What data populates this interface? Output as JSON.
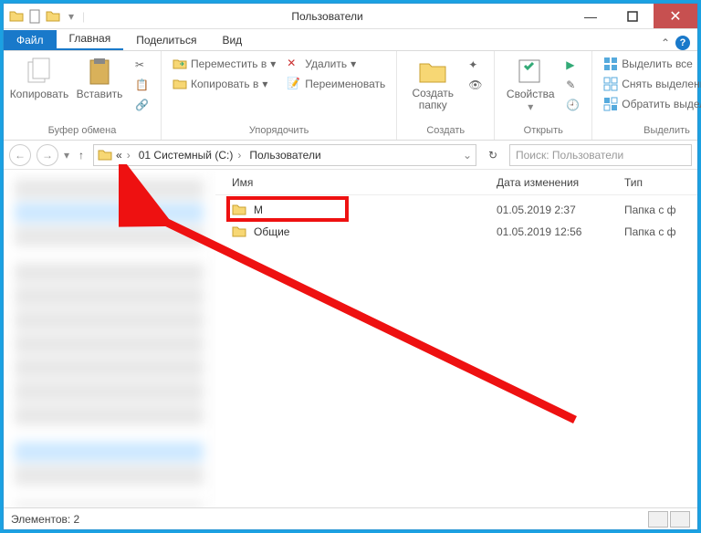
{
  "window": {
    "title": "Пользователи"
  },
  "tabs": {
    "file": "Файл",
    "home": "Главная",
    "share": "Поделиться",
    "view": "Вид"
  },
  "ribbon": {
    "clipboard": {
      "copy": "Копировать",
      "paste": "Вставить",
      "label": "Буфер обмена"
    },
    "organize": {
      "move": "Переместить в",
      "copyTo": "Копировать в",
      "delete": "Удалить",
      "rename": "Переименовать",
      "label": "Упорядочить"
    },
    "new": {
      "folder": "Создать папку",
      "label": "Создать"
    },
    "open": {
      "props": "Свойства",
      "label": "Открыть"
    },
    "select": {
      "all": "Выделить все",
      "none": "Снять выделение",
      "invert": "Обратить выделение",
      "label": "Выделить"
    }
  },
  "breadcrumbs": {
    "drive": "01 Системный (C:)",
    "folder": "Пользователи"
  },
  "search": {
    "placeholder": "Поиск: Пользователи"
  },
  "columns": {
    "name": "Имя",
    "date": "Дата изменения",
    "type": "Тип"
  },
  "items": [
    {
      "name": "M",
      "date": "01.05.2019 2:37",
      "type": "Папка с ф"
    },
    {
      "name": "Общие",
      "date": "01.05.2019 12:56",
      "type": "Папка с ф"
    }
  ],
  "status": {
    "text": "Элементов: 2"
  }
}
